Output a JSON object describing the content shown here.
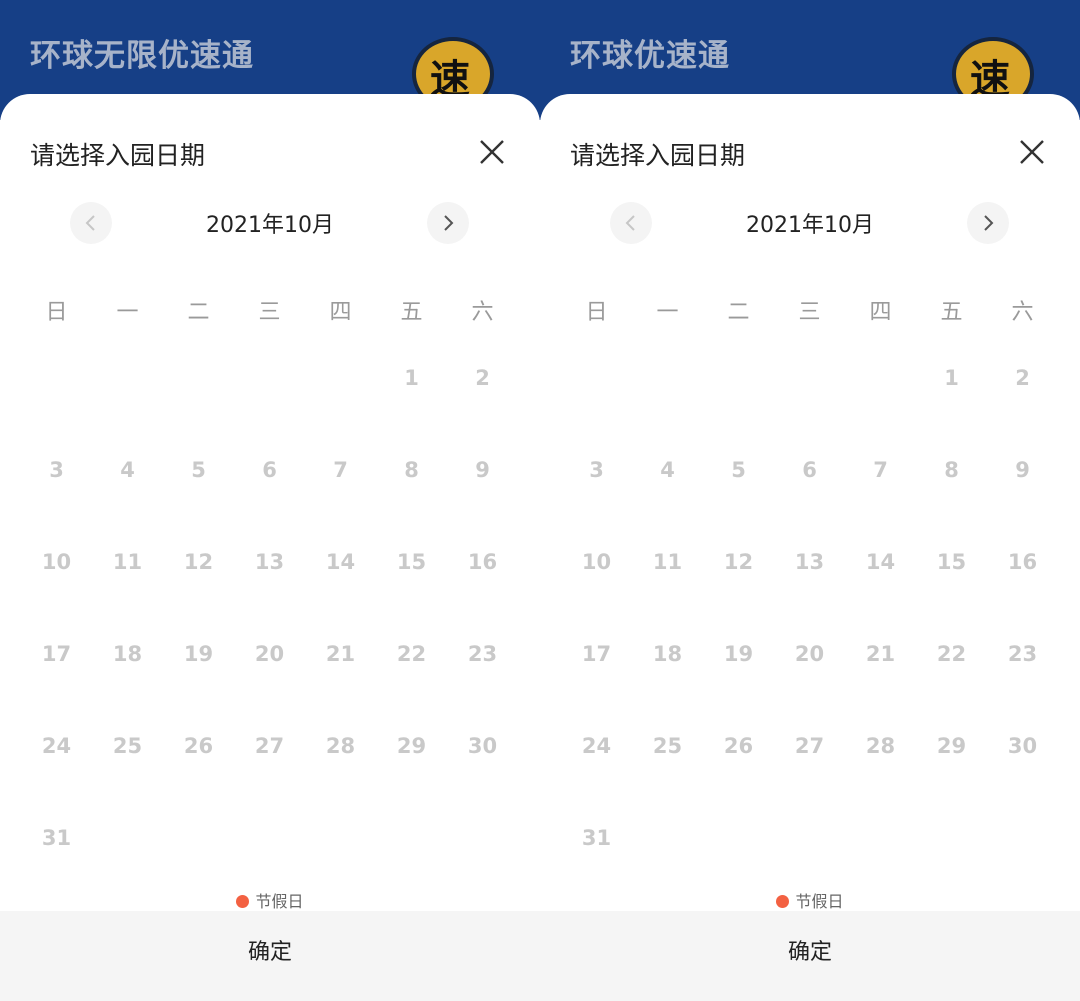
{
  "panels": [
    {
      "banner_title": "环球无限优速通",
      "logo_text": "速",
      "sheet_title": "请选择入园日期",
      "month_label": "2021年10月",
      "weekdays": [
        "日",
        "一",
        "二",
        "三",
        "四",
        "五",
        "六"
      ],
      "days": [
        "1",
        "2",
        "3",
        "4",
        "5",
        "6",
        "7",
        "8",
        "9",
        "10",
        "11",
        "12",
        "13",
        "14",
        "15",
        "16",
        "17",
        "18",
        "19",
        "20",
        "21",
        "22",
        "23",
        "24",
        "25",
        "26",
        "27",
        "28",
        "29",
        "30",
        "31"
      ],
      "legend_label": "节假日",
      "confirm_label": "确定",
      "colors": {
        "banner": "#163f86",
        "holiday_dot": "#f36142",
        "day_text": "#c9c9c9"
      }
    },
    {
      "banner_title": "环球优速通",
      "logo_text": "速",
      "sheet_title": "请选择入园日期",
      "month_label": "2021年10月",
      "weekdays": [
        "日",
        "一",
        "二",
        "三",
        "四",
        "五",
        "六"
      ],
      "days": [
        "1",
        "2",
        "3",
        "4",
        "5",
        "6",
        "7",
        "8",
        "9",
        "10",
        "11",
        "12",
        "13",
        "14",
        "15",
        "16",
        "17",
        "18",
        "19",
        "20",
        "21",
        "22",
        "23",
        "24",
        "25",
        "26",
        "27",
        "28",
        "29",
        "30",
        "31"
      ],
      "legend_label": "节假日",
      "confirm_label": "确定",
      "colors": {
        "banner": "#163f86",
        "holiday_dot": "#f36142",
        "day_text": "#c9c9c9"
      }
    }
  ],
  "icons": {
    "close": "close-icon",
    "prev": "chevron-left-icon",
    "next": "chevron-right-icon",
    "logo": "speed-logo-icon"
  }
}
